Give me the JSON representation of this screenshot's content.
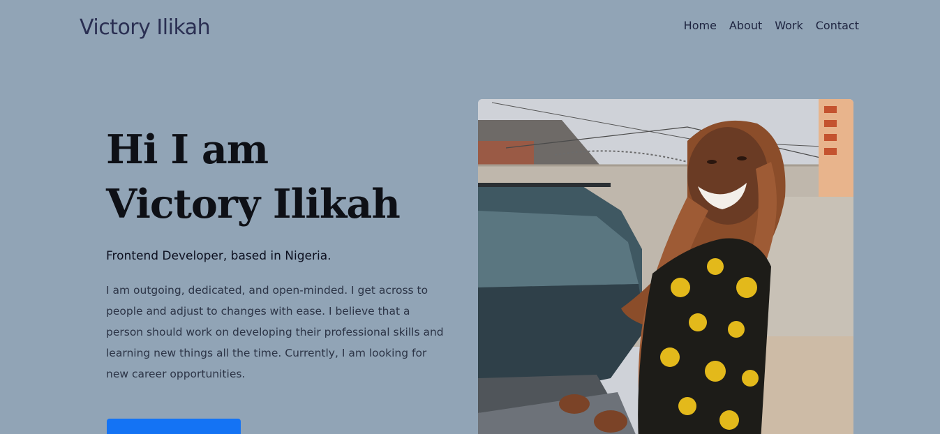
{
  "header": {
    "brand": "Victory Ilikah",
    "nav": [
      "Home",
      "About",
      "Work",
      "Contact"
    ]
  },
  "hero": {
    "title": "Hi I am Victory Ilikah",
    "subtitle": "Frontend Developer, based in Nigeria.",
    "bio": "I am outgoing, dedicated, and open-minded. I get across to people and adjust to changes with ease. I believe that a person should work on developing their professional skills and learning new things all the time. Currently, I am looking for new career opportunities.",
    "cta_label": ""
  },
  "colors": {
    "page_background": "#91a4b6",
    "cta_background": "#1473f4",
    "brand_text": "#2a2f52"
  }
}
